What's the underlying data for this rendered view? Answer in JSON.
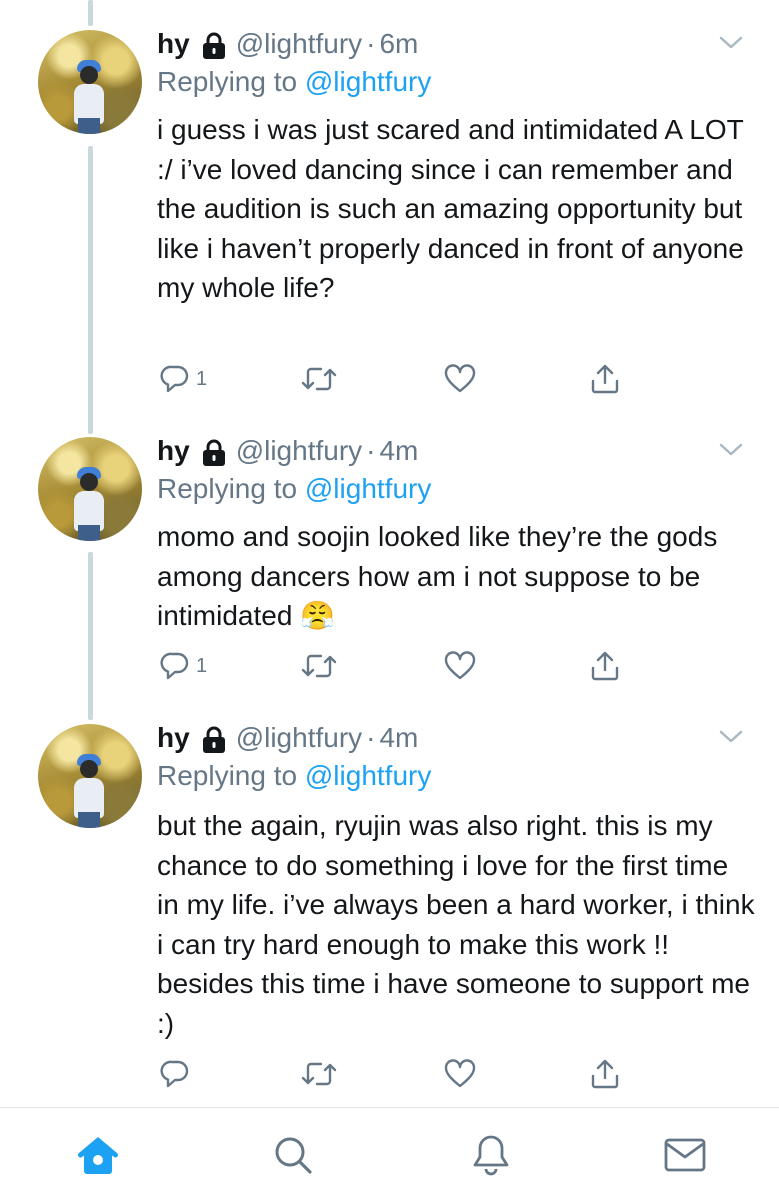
{
  "tweets": [
    {
      "name": "hy",
      "handle": "@lightfury",
      "separator": "·",
      "time": "6m",
      "replying_prefix": "Replying to ",
      "replying_to": "@lightfury",
      "text": "i guess i was just scared and intimidated A LOT :/ i’ve loved dancing since i can remember and the audition is such an amazing opportunity but like i haven’t properly danced in front of anyone my whole life?",
      "reply_count": "1"
    },
    {
      "name": "hy",
      "handle": "@lightfury",
      "separator": "·",
      "time": "4m",
      "replying_prefix": "Replying to ",
      "replying_to": "@lightfury",
      "text": "momo and soojin looked like they’re the gods among dancers how am i not suppose to be intimidated 😤",
      "reply_count": "1"
    },
    {
      "name": "hy",
      "handle": "@lightfury",
      "separator": "·",
      "time": "4m",
      "replying_prefix": "Replying to ",
      "replying_to": "@lightfury",
      "text": "but the again, ryujin was also right. this is my chance to do something i love for the first time in my life. i’ve always been a hard worker, i think i can try hard enough to make this work !! besides this time i have someone to support me :)",
      "reply_count": ""
    }
  ],
  "icons": {
    "accent": "#1da1f2",
    "muted": "#657786",
    "lock": "lock-icon",
    "chevron": "chevron-down-icon",
    "reply": "reply-icon",
    "retweet": "retweet-icon",
    "like": "heart-icon",
    "share": "share-icon"
  },
  "tabbar": {
    "tabs": [
      "home-icon",
      "search-icon",
      "notifications-icon",
      "messages-icon"
    ],
    "active": "home-icon"
  }
}
